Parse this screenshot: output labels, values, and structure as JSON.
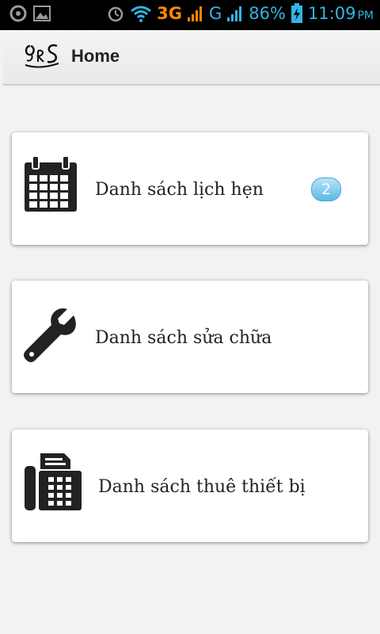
{
  "status_bar": {
    "network": "3G",
    "network2": "G",
    "battery": "86%",
    "time": "11:09",
    "ampm": "PM"
  },
  "action_bar": {
    "title": "Home",
    "logo_icon": "qrs-logo"
  },
  "menu": {
    "items": [
      {
        "label": "Danh sách lịch hẹn",
        "icon": "calendar-icon",
        "badge": "2"
      },
      {
        "label": "Danh sách sửa chữa",
        "icon": "wrench-icon"
      },
      {
        "label": "Danh sách thuê thiết bị",
        "icon": "fax-icon"
      }
    ]
  },
  "colors": {
    "status_text": "#33b5e5",
    "network_orange": "#ff8800",
    "badge": "#5db9e8"
  }
}
